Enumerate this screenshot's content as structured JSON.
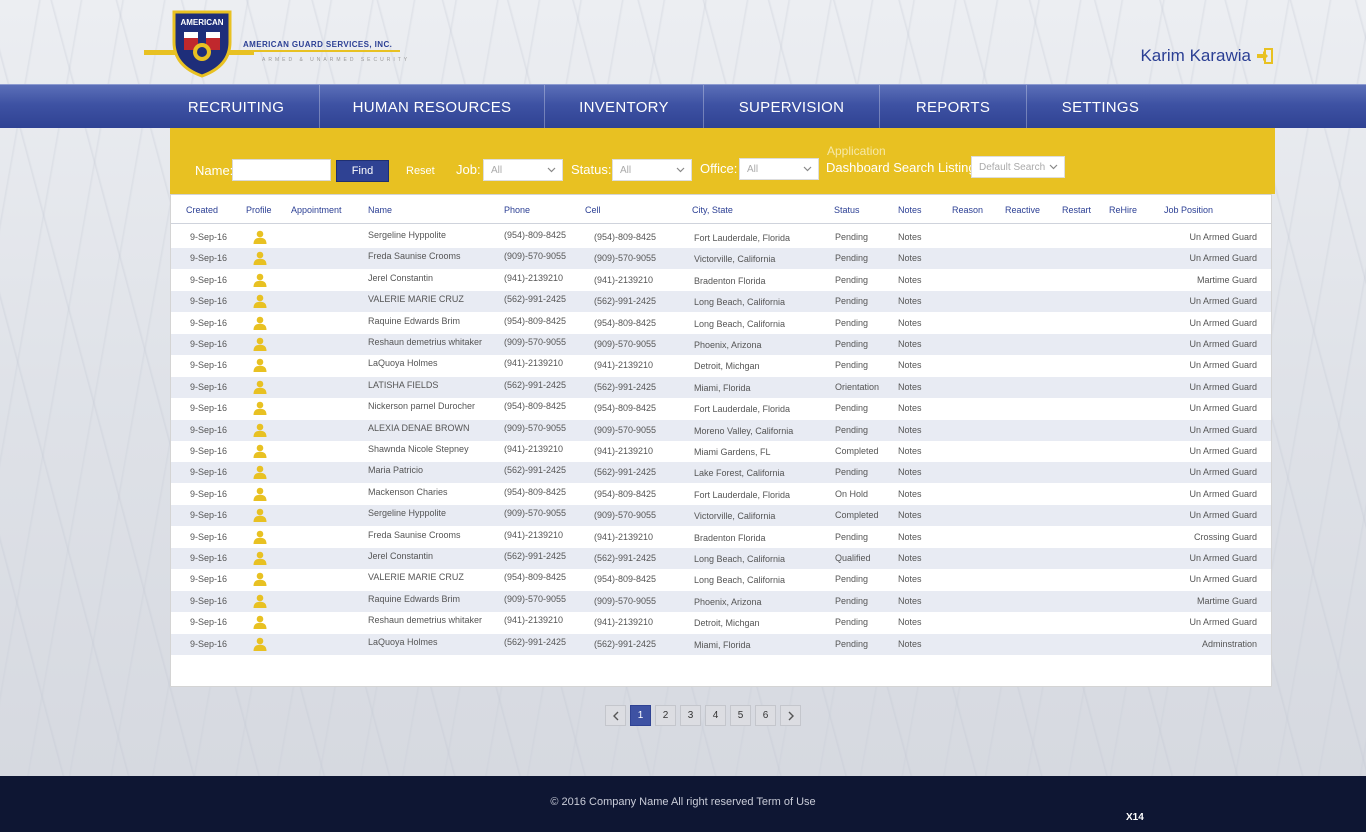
{
  "brand": {
    "company": "AMERICAN GUARD SERVICES, INC.",
    "tagline": "ARMED & UNARMED SECURITY",
    "badge_text": "AMERICAN"
  },
  "user": {
    "name": "Karim Karawia",
    "logout_icon": "sign-out-icon"
  },
  "nav": [
    "RECRUITING",
    "HUMAN RESOURCES",
    "INVENTORY",
    "SUPERVISION",
    "REPORTS",
    "SETTINGS"
  ],
  "filter": {
    "name_label": "Name:",
    "name_value": "",
    "find_label": "Find",
    "reset_label": "Reset",
    "job_label": "Job:",
    "job_value": "All",
    "status_label": "Status:",
    "status_value": "All",
    "office_label": "Office:",
    "office_value": "All",
    "app_label": "Application",
    "dashboard_label": "Dashboard Search Listing:",
    "dashboard_value": "Default Search"
  },
  "columns": [
    "Created",
    "Profile",
    "Appointment",
    "Name",
    "Phone",
    "Cell",
    "City, State",
    "Status",
    "Notes",
    "Reason",
    "Reactive",
    "Restart",
    "ReHire",
    "Job Position"
  ],
  "rows": [
    {
      "created": "9-Sep-16",
      "name": "Sergeline Hyppolite",
      "phone": "(954)-809-8425",
      "cell": "(954)-809-8425",
      "city": "Fort Lauderdale, Florida",
      "status": "Pending",
      "notes": "Notes",
      "job": "Un Armed Guard"
    },
    {
      "created": "9-Sep-16",
      "name": "Freda Saunise Crooms",
      "phone": "(909)-570-9055",
      "cell": "(909)-570-9055",
      "city": "Victorville, California",
      "status": "Pending",
      "notes": "Notes",
      "job": "Un Armed Guard"
    },
    {
      "created": "9-Sep-16",
      "name": "Jerel Constantin",
      "phone": "(941)-2139210",
      "cell": "(941)-2139210",
      "city": "Bradenton Florida",
      "status": "Pending",
      "notes": "Notes",
      "job": "Martime Guard"
    },
    {
      "created": "9-Sep-16",
      "name": "VALERIE MARIE CRUZ",
      "phone": "(562)-991-2425",
      "cell": "(562)-991-2425",
      "city": "Long Beach, California",
      "status": "Pending",
      "notes": "Notes",
      "job": "Un Armed Guard"
    },
    {
      "created": "9-Sep-16",
      "name": "Raquine Edwards Brim",
      "phone": "(954)-809-8425",
      "cell": "(954)-809-8425",
      "city": "Long Beach, California",
      "status": "Pending",
      "notes": "Notes",
      "job": "Un Armed Guard"
    },
    {
      "created": "9-Sep-16",
      "name": "Reshaun demetrius whitaker",
      "phone": "(909)-570-9055",
      "cell": "(909)-570-9055",
      "city": "Phoenix, Arizona",
      "status": "Pending",
      "notes": "Notes",
      "job": "Un Armed Guard"
    },
    {
      "created": "9-Sep-16",
      "name": "LaQuoya Holmes",
      "phone": "(941)-2139210",
      "cell": "(941)-2139210",
      "city": "Detroit, Michgan",
      "status": "Pending",
      "notes": "Notes",
      "job": "Un Armed Guard"
    },
    {
      "created": "9-Sep-16",
      "name": "LATISHA FIELDS",
      "phone": "(562)-991-2425",
      "cell": "(562)-991-2425",
      "city": "Miami, Florida",
      "status": "Orientation",
      "notes": "Notes",
      "job": "Un Armed Guard"
    },
    {
      "created": "9-Sep-16",
      "name": "Nickerson parnel Durocher",
      "phone": "(954)-809-8425",
      "cell": "(954)-809-8425",
      "city": "Fort Lauderdale, Florida",
      "status": "Pending",
      "notes": "Notes",
      "job": "Un Armed Guard"
    },
    {
      "created": "9-Sep-16",
      "name": "ALEXIA DENAE BROWN",
      "phone": "(909)-570-9055",
      "cell": "(909)-570-9055",
      "city": "Moreno Valley, California",
      "status": "Pending",
      "notes": "Notes",
      "job": "Un Armed Guard"
    },
    {
      "created": "9-Sep-16",
      "name": "Shawnda Nicole Stepney",
      "phone": "(941)-2139210",
      "cell": "(941)-2139210",
      "city": "Miami Gardens, FL",
      "status": "Completed",
      "notes": "Notes",
      "job": "Un Armed Guard"
    },
    {
      "created": "9-Sep-16",
      "name": "Maria Patricio",
      "phone": "(562)-991-2425",
      "cell": "(562)-991-2425",
      "city": "Lake Forest, California",
      "status": "Pending",
      "notes": "Notes",
      "job": "Un Armed Guard"
    },
    {
      "created": "9-Sep-16",
      "name": "Mackenson Charies",
      "phone": "(954)-809-8425",
      "cell": "(954)-809-8425",
      "city": "Fort Lauderdale, Florida",
      "status": "On Hold",
      "notes": "Notes",
      "job": "Un Armed Guard"
    },
    {
      "created": "9-Sep-16",
      "name": "Sergeline Hyppolite",
      "phone": "(909)-570-9055",
      "cell": "(909)-570-9055",
      "city": "Victorville, California",
      "status": "Completed",
      "notes": "Notes",
      "job": "Un Armed Guard"
    },
    {
      "created": "9-Sep-16",
      "name": "Freda Saunise Crooms",
      "phone": "(941)-2139210",
      "cell": "(941)-2139210",
      "city": "Bradenton Florida",
      "status": "Pending",
      "notes": "Notes",
      "job": "Crossing Guard"
    },
    {
      "created": "9-Sep-16",
      "name": "Jerel Constantin",
      "phone": "(562)-991-2425",
      "cell": "(562)-991-2425",
      "city": "Long Beach, California",
      "status": "Qualified",
      "notes": "Notes",
      "job": "Un Armed Guard"
    },
    {
      "created": "9-Sep-16",
      "name": "VALERIE MARIE CRUZ",
      "phone": "(954)-809-8425",
      "cell": "(954)-809-8425",
      "city": "Long Beach, California",
      "status": "Pending",
      "notes": "Notes",
      "job": "Un Armed Guard"
    },
    {
      "created": "9-Sep-16",
      "name": "Raquine Edwards Brim",
      "phone": "(909)-570-9055",
      "cell": "(909)-570-9055",
      "city": "Phoenix, Arizona",
      "status": "Pending",
      "notes": "Notes",
      "job": "Martime Guard"
    },
    {
      "created": "9-Sep-16",
      "name": "Reshaun demetrius whitaker",
      "phone": "(941)-2139210",
      "cell": "(941)-2139210",
      "city": "Detroit, Michgan",
      "status": "Pending",
      "notes": "Notes",
      "job": "Un Armed Guard"
    },
    {
      "created": "9-Sep-16",
      "name": "LaQuoya Holmes",
      "phone": "(562)-991-2425",
      "cell": "(562)-991-2425",
      "city": "Miami, Florida",
      "status": "Pending",
      "notes": "Notes",
      "job": "Adminstration"
    }
  ],
  "pagination": {
    "pages": [
      "1",
      "2",
      "3",
      "4",
      "5",
      "6"
    ],
    "current": "1"
  },
  "footer": {
    "copyright": "© 2016 Company Name  All right reserved  Term of Use",
    "tag": "X14"
  },
  "colors": {
    "brand_blue": "#2f4293",
    "accent_yellow": "#e8c122",
    "footer_navy": "#0e1633"
  }
}
